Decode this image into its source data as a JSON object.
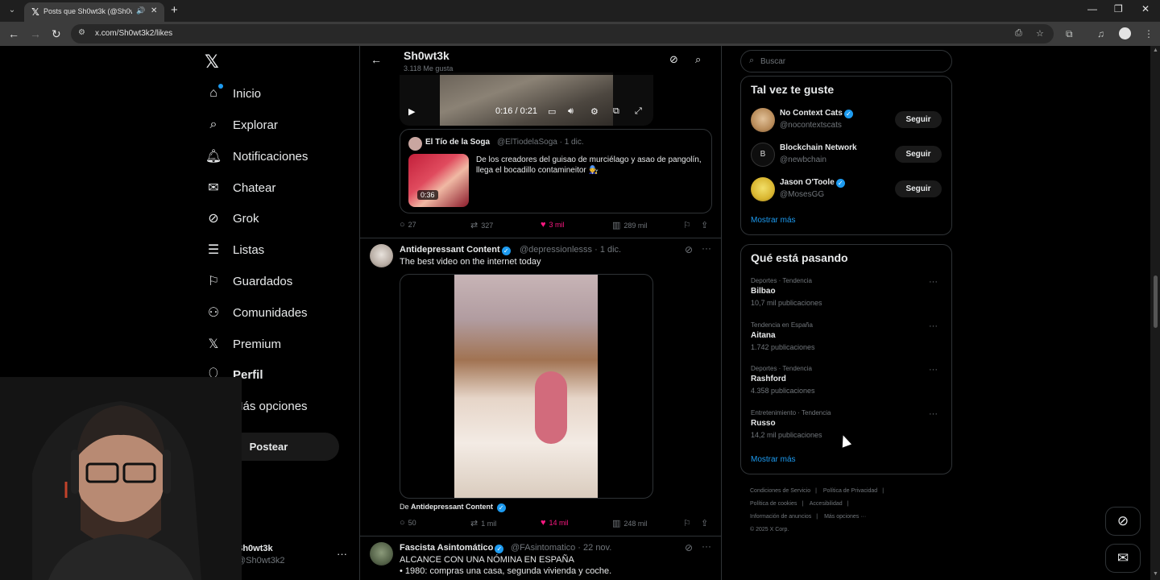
{
  "browser": {
    "tab_title": "Posts que Sh0wt3k (@Sh0wt3k2)",
    "url": "x.com/Sh0wt3k2/likes"
  },
  "nav": {
    "items": [
      {
        "label": "Inicio",
        "icon": "home-icon"
      },
      {
        "label": "Explorar",
        "icon": "search-icon"
      },
      {
        "label": "Notificaciones",
        "icon": "bell-icon"
      },
      {
        "label": "Chatear",
        "icon": "mail-icon"
      },
      {
        "label": "Grok",
        "icon": "grok-icon"
      },
      {
        "label": "Listas",
        "icon": "list-icon"
      },
      {
        "label": "Guardados",
        "icon": "bookmark-icon"
      },
      {
        "label": "Comunidades",
        "icon": "communities-icon"
      },
      {
        "label": "Premium",
        "icon": "x-icon"
      },
      {
        "label": "Perfil",
        "icon": "person-icon"
      },
      {
        "label": "Más opciones",
        "icon": "more-circle-icon"
      }
    ],
    "post_button": "Postear",
    "account": {
      "name": "Sh0wt3k",
      "handle": "@Sh0wt3k2"
    }
  },
  "header": {
    "name": "Sh0wt3k",
    "likes": "3.118 Me gusta"
  },
  "post1": {
    "video_time": "0:16 / 0:21",
    "quote": {
      "name": "El Tío de la Soga",
      "meta": "@ElTiodelaSoga · 1 dic.",
      "duration": "0:36",
      "text": "De los creadores del guisao de murciélago y asao de pangolín, llega el bocadillo contamineitor 🧑‍🔧"
    },
    "replies": "27",
    "reposts": "327",
    "likes": "3 mil",
    "views": "289 mil"
  },
  "post2": {
    "name": "Antidepressant Content",
    "meta": "@depressionlesss · 1 dic.",
    "text": "The best video on the internet today",
    "from_prefix": "De",
    "from_name": "Antidepressant Content",
    "replies": "50",
    "reposts": "1 mil",
    "likes": "14 mil",
    "views": "248 mil"
  },
  "post3": {
    "name": "Fascista Asintomático",
    "meta": "@FAsintomatico · 22 nov.",
    "line1": "ALCANCE CON UNA NÓMINA EN ESPAÑA",
    "line2": "• 1980: compras una casa, segunda vivienda y coche."
  },
  "search": {
    "placeholder": "Buscar"
  },
  "suggestions": {
    "title": "Tal vez te guste",
    "follow_label": "Seguir",
    "items": [
      {
        "name": "No Context Cats",
        "handle": "@nocontextscats"
      },
      {
        "name": "Blockchain Network",
        "handle": "@newbchain"
      },
      {
        "name": "Jason O'Toole",
        "handle": "@MosesGG"
      }
    ],
    "more": "Mostrar más"
  },
  "trends": {
    "title": "Qué está pasando",
    "items": [
      {
        "context": "Deportes · Tendencia",
        "name": "Bilbao",
        "count": "10,7 mil publicaciones"
      },
      {
        "context": "Tendencia en España",
        "name": "Aitana",
        "count": "1.742 publicaciones"
      },
      {
        "context": "Deportes · Tendencia",
        "name": "Rashford",
        "count": "4.358 publicaciones"
      },
      {
        "context": "Entretenimiento · Tendencia",
        "name": "Russo",
        "count": "14,2 mil publicaciones"
      }
    ],
    "more": "Mostrar más"
  },
  "footer": {
    "links": [
      "Condiciones de Servicio",
      "Política de Privacidad",
      "Política de cookies",
      "Accesibilidad",
      "Información de anuncios",
      "Más opciones ···"
    ],
    "copyright": "© 2025 X Corp."
  }
}
